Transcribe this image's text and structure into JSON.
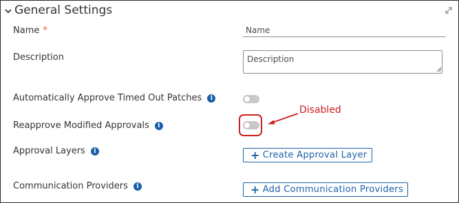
{
  "panel": {
    "title": "General Settings",
    "header_icons": {
      "collapse": "chevron-down-icon",
      "expand": "expand-icon"
    }
  },
  "fields": {
    "name": {
      "label": "Name",
      "required_marker": "*",
      "placeholder": "Name"
    },
    "description": {
      "label": "Description",
      "placeholder": "Description"
    },
    "auto_approve": {
      "label": "Automatically Approve Timed Out Patches",
      "info_icon": "i",
      "enabled": false
    },
    "reapprove": {
      "label": "Reapprove Modified Approvals",
      "info_icon": "i",
      "enabled": false
    },
    "approval_layers": {
      "label": "Approval Layers",
      "info_icon": "i",
      "button_label": "Create Approval Layer"
    },
    "communication_providers": {
      "label": "Communication Providers",
      "info_icon": "i",
      "button_label": "Add Communication Providers"
    }
  },
  "annotation": {
    "text": "Disabled",
    "color": "#cc1f1f"
  },
  "colors": {
    "accent": "#1a5fa8",
    "required": "#e05a3d",
    "toggle_off": "#c8c8c8"
  }
}
